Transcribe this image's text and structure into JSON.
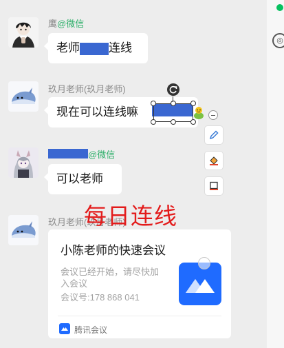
{
  "messages": [
    {
      "sender": "鹰",
      "sender_app": "@微信",
      "text_before": "老师",
      "text_after": "连线"
    },
    {
      "sender": "玖月老师(玖月老师)",
      "text": "现在可以连线嘛"
    },
    {
      "sender_app": "@微信",
      "text": "可以老师"
    }
  ],
  "watermark": "每日连线",
  "card": {
    "sender": "玖月老师(玖月老师)",
    "title": "小陈老师的快速会议",
    "desc_line1": "会议已经开始，请尽快加",
    "desc_line2": "入会议",
    "meeting_no": "会议号:178 868 041",
    "app": "腾讯会议"
  },
  "colors": {
    "redaction": "#3a67d1",
    "watermark": "#e31b1b",
    "wechat_green": "#2aae67",
    "meeting_blue": "#1f6bff"
  },
  "icons": [
    "rotate-icon",
    "sticker-icon",
    "minus-icon",
    "pen-icon",
    "fill-icon",
    "crop-icon",
    "tencent-meeting-icon"
  ]
}
